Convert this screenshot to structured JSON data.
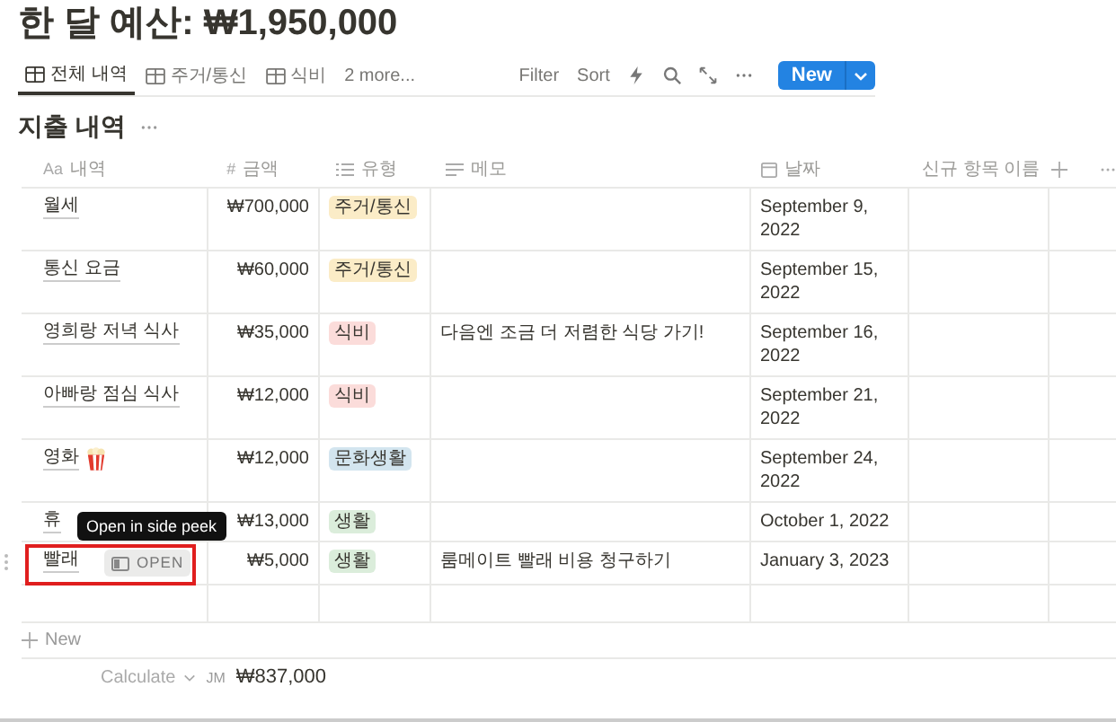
{
  "title": "한 달 예산: ₩1,950,000",
  "tabs": [
    {
      "label": "전체 내역",
      "selected": true
    },
    {
      "label": "주거/통신",
      "selected": false
    },
    {
      "label": "식비",
      "selected": false
    }
  ],
  "more_views": "2 more...",
  "toolbar": [
    {
      "kind": "text",
      "label": "Filter"
    },
    {
      "kind": "text",
      "label": "Sort"
    },
    {
      "kind": "bolt"
    },
    {
      "kind": "search"
    },
    {
      "kind": "expand"
    },
    {
      "kind": "more"
    }
  ],
  "new_button": "New",
  "section_title": "지출 내역",
  "columns": [
    {
      "kind": "title",
      "type_mark": "Aa",
      "label": "내역"
    },
    {
      "kind": "number",
      "type_mark": "#",
      "label": "금액"
    },
    {
      "kind": "select",
      "label": "유형"
    },
    {
      "kind": "text",
      "label": "메모"
    },
    {
      "kind": "date",
      "label": "날짜"
    },
    {
      "kind": "text",
      "label": "신규 항목 이름"
    }
  ],
  "rows": [
    {
      "name": "월세",
      "amount": "₩700,000",
      "tag": {
        "label": "주거/통신",
        "color": "#fbecc7"
      },
      "memo": "",
      "date": "September 9, 2022",
      "hovered": false,
      "popcorn": false
    },
    {
      "name": "통신 요금",
      "amount": "₩60,000",
      "tag": {
        "label": "주거/통신",
        "color": "#fbecc7"
      },
      "memo": "",
      "date": "September 15, 2022",
      "hovered": false,
      "popcorn": false
    },
    {
      "name": "영희랑 저녁 식사",
      "amount": "₩35,000",
      "tag": {
        "label": "식비",
        "color": "#fbdcda"
      },
      "memo": "다음엔 조금 더 저렴한 식당 가기!",
      "date": "September 16, 2022",
      "hovered": false,
      "popcorn": false
    },
    {
      "name": "아빠랑 점심 식사",
      "amount": "₩12,000",
      "tag": {
        "label": "식비",
        "color": "#fbdcda"
      },
      "memo": "",
      "date": "September 21, 2022",
      "hovered": false,
      "popcorn": false
    },
    {
      "name": "영화",
      "popcorn": true,
      "amount": "₩12,000",
      "tag": {
        "label": "문화생활",
        "color": "#d3e5ef"
      },
      "memo": "",
      "date": "September 24, 2022",
      "hovered": false
    },
    {
      "name": "휴",
      "amount": "₩13,000",
      "tag": {
        "label": "생활",
        "color": "#dbeddb"
      },
      "memo": "",
      "date": "October 1, 2022",
      "hovered": false,
      "popcorn": false
    },
    {
      "name": "빨래",
      "amount": "₩5,000",
      "tag": {
        "label": "생활",
        "color": "#dbeddb"
      },
      "memo": "룸메이트 빨래 비용 청구하기",
      "date": "January 3, 2023",
      "hovered": true,
      "popcorn": false
    }
  ],
  "open_button": "OPEN",
  "tooltip": "Open in side peek",
  "add_row": "New",
  "footer": {
    "calculate": "Calculate",
    "sum_label": "JM",
    "sum": "₩837,000"
  }
}
